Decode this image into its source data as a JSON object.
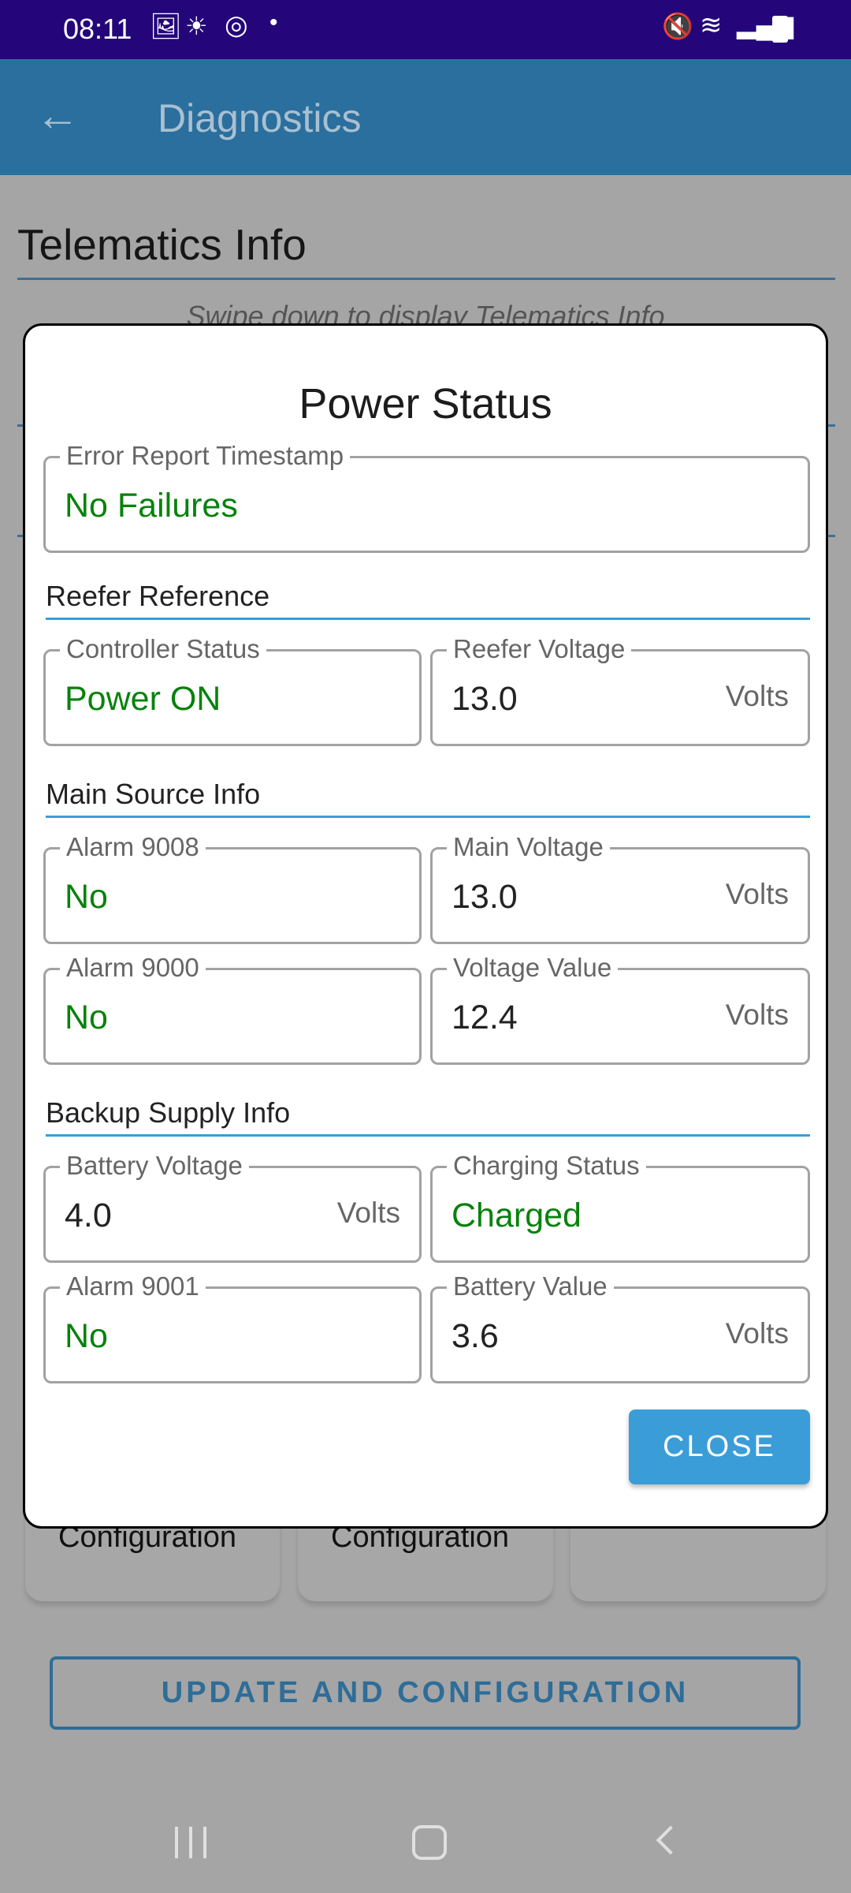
{
  "status_bar": {
    "time": "08:11",
    "icons": [
      "image-icon",
      "weather-icon",
      "sync-icon",
      "dot-icon",
      "mute-icon",
      "wifi-icon",
      "signal-icon",
      "battery-icon"
    ]
  },
  "app_bar": {
    "title": "Diagnostics",
    "back_icon": "arrow-left-icon"
  },
  "background": {
    "section_title": "Telematics Info",
    "hint": "Swipe down to display Telematics Info",
    "cards": [
      {
        "label": "Configuration"
      },
      {
        "label": "Configuration"
      },
      {
        "label": ""
      }
    ],
    "update_button": "UPDATE AND CONFIGURATION"
  },
  "dialog": {
    "title": "Power Status",
    "error_report": {
      "label": "Error Report Timestamp",
      "value": "No Failures"
    },
    "sections": [
      {
        "title": "Reefer Reference",
        "fields": [
          {
            "label": "Controller Status",
            "value": "Power ON",
            "unit": "",
            "status": true
          },
          {
            "label": "Reefer Voltage",
            "value": "13.0",
            "unit": "Volts",
            "status": false
          }
        ]
      },
      {
        "title": "Main Source Info",
        "fields": [
          {
            "label": "Alarm 9008",
            "value": "No",
            "unit": "",
            "status": true
          },
          {
            "label": "Main Voltage",
            "value": "13.0",
            "unit": "Volts",
            "status": false
          },
          {
            "label": "Alarm 9000",
            "value": "No",
            "unit": "",
            "status": true
          },
          {
            "label": "Voltage Value",
            "value": "12.4",
            "unit": "Volts",
            "status": false
          }
        ]
      },
      {
        "title": "Backup Supply Info",
        "fields": [
          {
            "label": "Battery Voltage",
            "value": "4.0",
            "unit": "Volts",
            "status": false
          },
          {
            "label": "Charging Status",
            "value": "Charged",
            "unit": "",
            "status": true
          },
          {
            "label": "Alarm 9001",
            "value": "No",
            "unit": "",
            "status": true
          },
          {
            "label": "Battery Value",
            "value": "3.6",
            "unit": "Volts",
            "status": false
          }
        ]
      }
    ],
    "close_label": "CLOSE"
  },
  "colors": {
    "status_ok": "#08820c",
    "accent": "#3a9dd8",
    "status_bar": "#24067a"
  },
  "nav_bar": {
    "icons": [
      "recents-icon",
      "home-icon",
      "back-icon"
    ]
  }
}
